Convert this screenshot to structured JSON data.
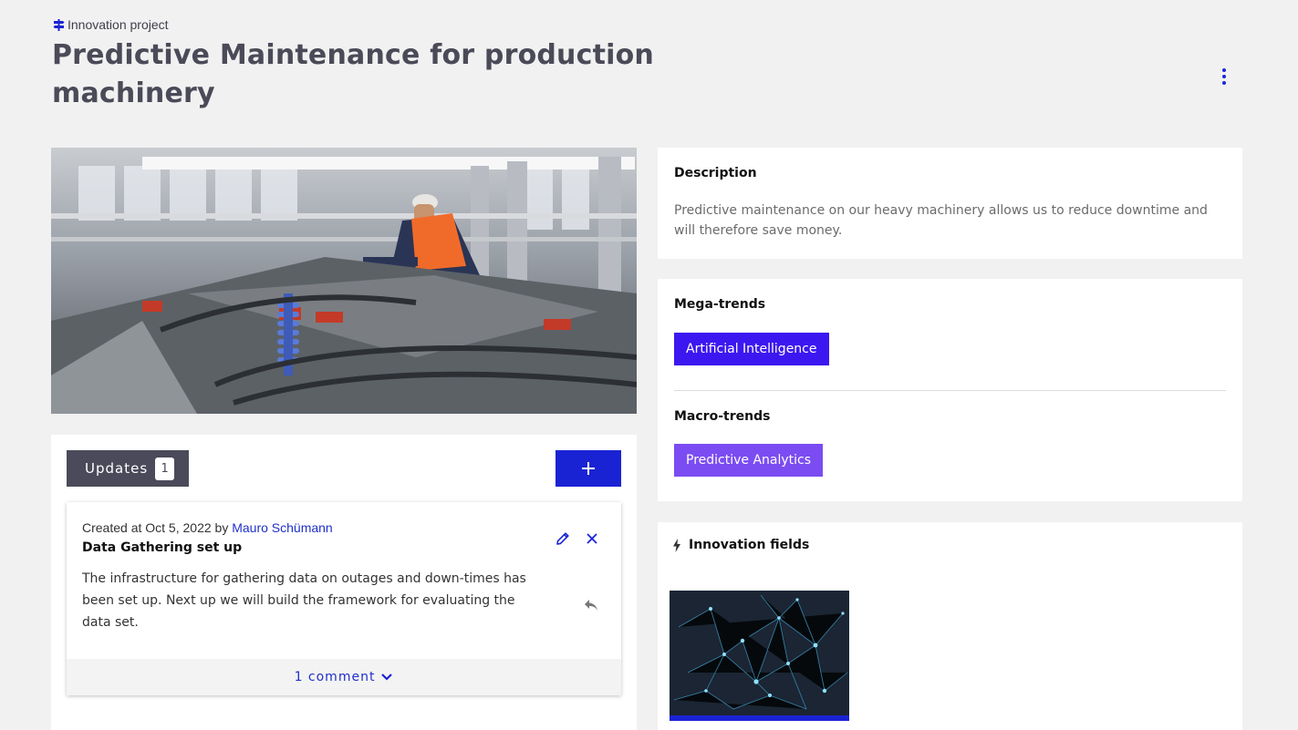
{
  "header": {
    "type_label": "Innovation project",
    "type_icon": "signpost-icon",
    "title": "Predictive Maintenance for production machinery",
    "menu_icon": "more-vertical-icon"
  },
  "hero_image": {
    "description_icon": "factory-photo"
  },
  "updates": {
    "tab_label": "Updates",
    "count": "1",
    "add_icon": "plus-icon",
    "items": [
      {
        "created_prefix": "Created at Oct 5, 2022 by",
        "author": "Mauro Schümann",
        "title": "Data Gathering set up",
        "body": "The infrastructure for gathering data on outages and down-times has been set up. Next up we will build the framework for evaluating the data set.",
        "comments_label": "1 comment"
      }
    ]
  },
  "description": {
    "heading": "Description",
    "text": "Predictive maintenance on our heavy machinery allows us to reduce downtime and will therefore save money."
  },
  "trends": {
    "mega_heading": "Mega-trends",
    "mega_tags": [
      "Artificial Intelligence"
    ],
    "macro_heading": "Macro-trends",
    "macro_tags": [
      "Predictive Analytics"
    ]
  },
  "innovation_fields": {
    "heading": "Innovation fields",
    "icon": "bolt-icon"
  },
  "colors": {
    "accent": "#1a23d4",
    "mega_tag": "#3d17f0",
    "macro_tag": "#7b4cf2",
    "tab_dark": "#4b4a5a",
    "background": "#f1f1f1"
  }
}
